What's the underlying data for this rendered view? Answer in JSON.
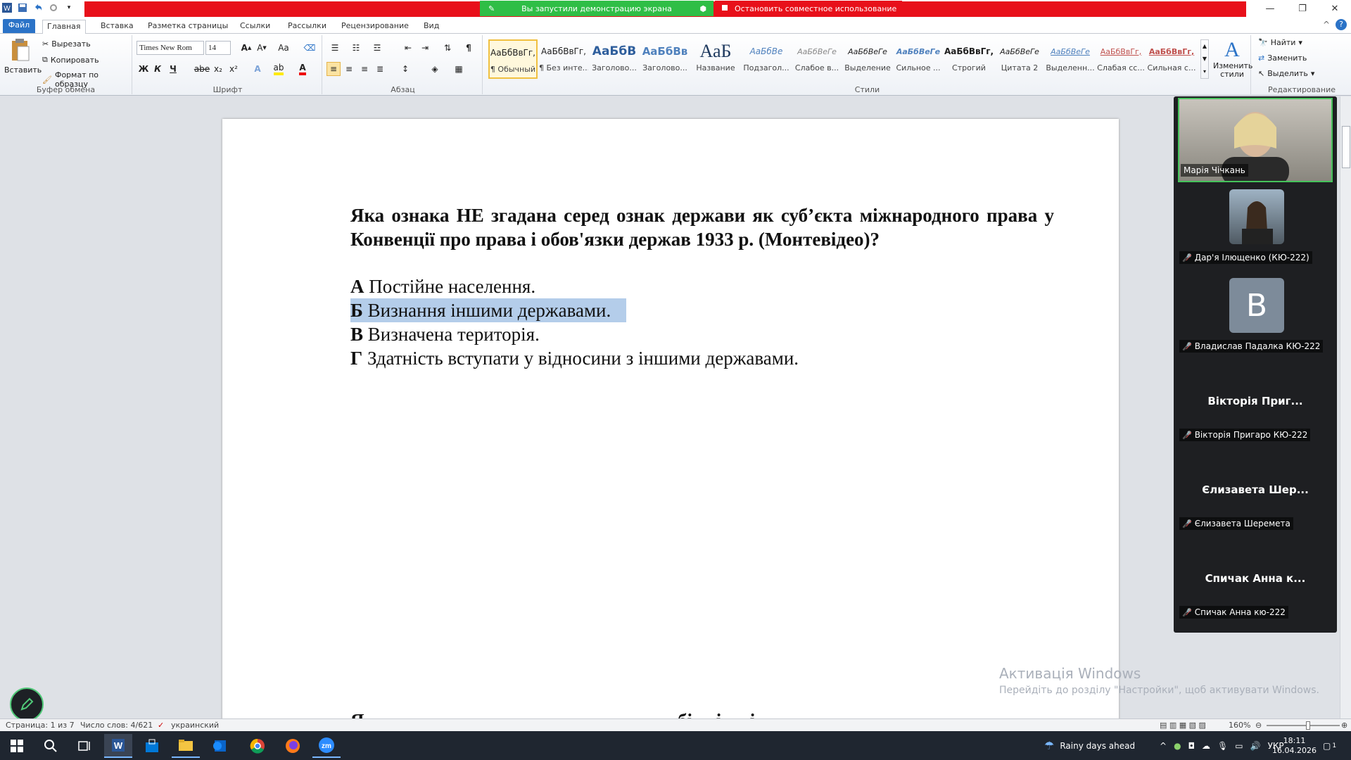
{
  "titlebar": {
    "share_status": "Вы запустили демонстрацию экрана",
    "stop_share": "Остановить совместное использование"
  },
  "tabs": [
    "Файл",
    "Главная",
    "Вставка",
    "Разметка страницы",
    "Ссылки",
    "Рассылки",
    "Рецензирование",
    "Вид"
  ],
  "clipboard": {
    "paste": "Вставить",
    "cut": "Вырезать",
    "copy": "Копировать",
    "format_painter": "Формат по образцу",
    "label": "Буфер обмена"
  },
  "font": {
    "name": "Times New Rom",
    "size": "14",
    "label": "Шрифт",
    "bold": "Ж",
    "italic": "К",
    "underline": "Ч",
    "strike": "abe",
    "sub": "x₂",
    "sup": "x²",
    "case": "Aa"
  },
  "paragraph": {
    "label": "Абзац"
  },
  "styles": {
    "label": "Стили",
    "items": [
      {
        "preview": "АаБбВвГг,",
        "name": "¶ Обычный"
      },
      {
        "preview": "АаБбВвГг,",
        "name": "¶ Без инте..."
      },
      {
        "preview": "АаБбВ",
        "name": "Заголово..."
      },
      {
        "preview": "АаБбВв",
        "name": "Заголово..."
      },
      {
        "preview": "АаБ",
        "name": "Название"
      },
      {
        "preview": "АаБбВе",
        "name": "Подзагол..."
      },
      {
        "preview": "АаБбВеГе",
        "name": "Слабое в..."
      },
      {
        "preview": "АаБбВеГе",
        "name": "Выделение"
      },
      {
        "preview": "АаБбВеГе",
        "name": "Сильное ..."
      },
      {
        "preview": "АаБбВвГг,",
        "name": "Строгий"
      },
      {
        "preview": "АаБбВеГе",
        "name": "Цитата 2"
      },
      {
        "preview": "АаБбВеГе",
        "name": "Выделенн..."
      },
      {
        "preview": "АаБбВвГг,",
        "name": "Слабая сс..."
      },
      {
        "preview": "АаБбВвГг,",
        "name": "Сильная с..."
      }
    ],
    "change": "Изменить стили"
  },
  "editing": {
    "find": "Найти",
    "replace": "Заменить",
    "select": "Выделить",
    "label": "Редактирование"
  },
  "document": {
    "question": "Яка ознака НЕ згадана серед ознак держави як суб’єкта міжнародного права у Конвенції про права і обов'язки держав 1933 р. (Монтевідео)?",
    "answers": [
      {
        "letter": "А",
        "text": "Постійне населення."
      },
      {
        "letter": "Б",
        "text": "Визнання іншими державами."
      },
      {
        "letter": "В",
        "text": "Визначена територія."
      },
      {
        "letter": "Г",
        "text": "Здатність вступати у відносини з іншими державами."
      }
    ],
    "bottom_partial": "Я                                                                  бі     і      і"
  },
  "activation": {
    "title": "Активація Windows",
    "subtitle": "Перейдіть до розділу \"Настройки\", щоб активувати Windows."
  },
  "zoom": {
    "participants": [
      {
        "name": "Марія Чічкань",
        "type": "video"
      },
      {
        "name": "Дар'я Ілющенко (КЮ-222)",
        "type": "photo"
      },
      {
        "name": "Владислав Падалка КЮ-222",
        "type": "avatar",
        "initial": "В"
      },
      {
        "name": "Вікторія Пригаро КЮ-222",
        "type": "text",
        "display": "Вікторія Приг..."
      },
      {
        "name": "Єлизавета Шеремета",
        "type": "text",
        "display": "Єлизавета Шер..."
      },
      {
        "name": "Спичак Анна кю-222",
        "type": "text",
        "display": "Спичак Анна к..."
      }
    ]
  },
  "statusbar": {
    "page": "Страница: 1 из 7",
    "words": "Число слов: 4/621",
    "language": "украинский",
    "zoom": "160%"
  },
  "taskbar": {
    "weather": "Rainy days ahead",
    "lang": "УКР",
    "time": "18:11",
    "date": "16.04.2026",
    "notifications": "1"
  },
  "colors": {
    "accent": "#2b73c7",
    "share_green": "#2fbe46",
    "share_red": "#e8101a",
    "highlight": "#b4cdea"
  }
}
